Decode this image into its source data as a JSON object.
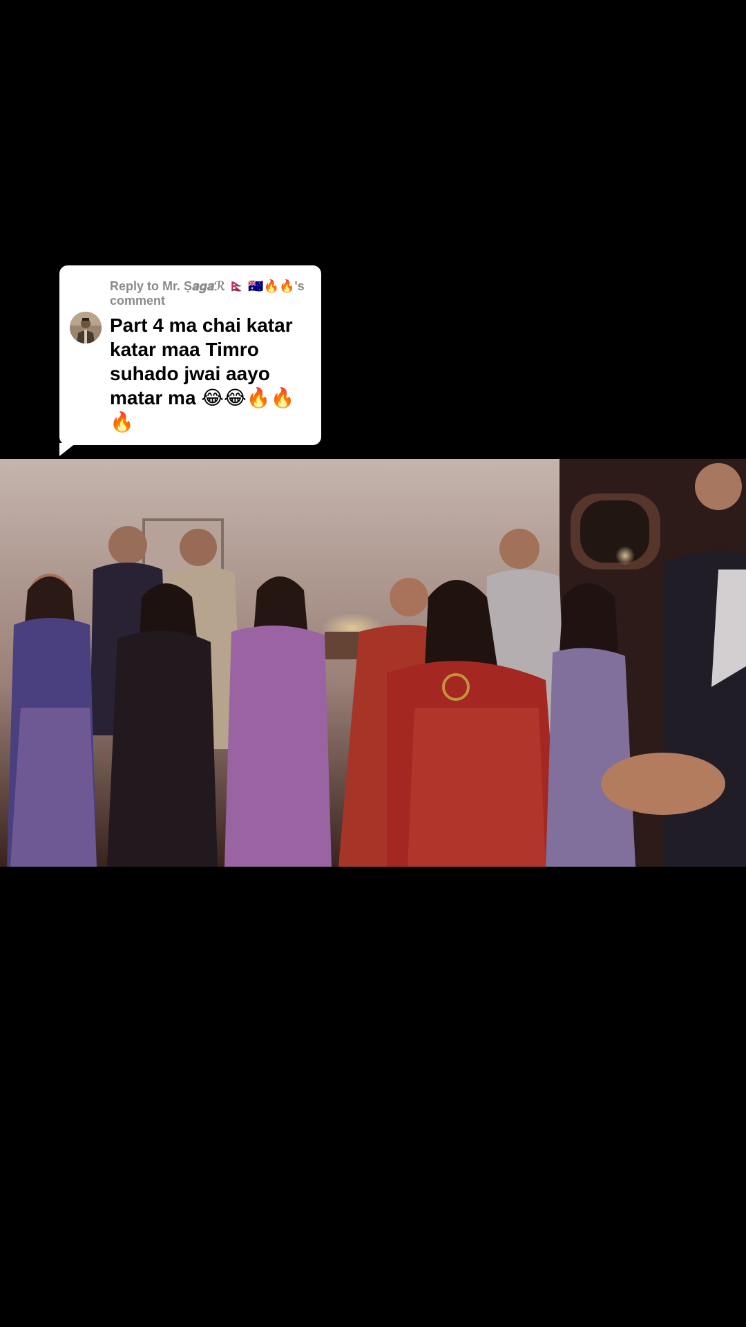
{
  "reply_sticker": {
    "header": "Reply to Mr. Ṣ𝒂𝒈𝒂ℛ 🇳🇵 🇦🇺🔥🔥's comment",
    "comment_text": "Part 4 ma chai katar katar maa Timro suhado jwai aayo matar ma 😂😂🔥🔥🔥",
    "avatar_icon": "user-avatar-photo"
  },
  "video": {
    "scene": "wedding-party-crowd-frame"
  },
  "colors": {
    "background": "#000000",
    "sticker_bg": "#ffffff",
    "header_text": "#8a8a8a",
    "comment_text": "#000000"
  }
}
